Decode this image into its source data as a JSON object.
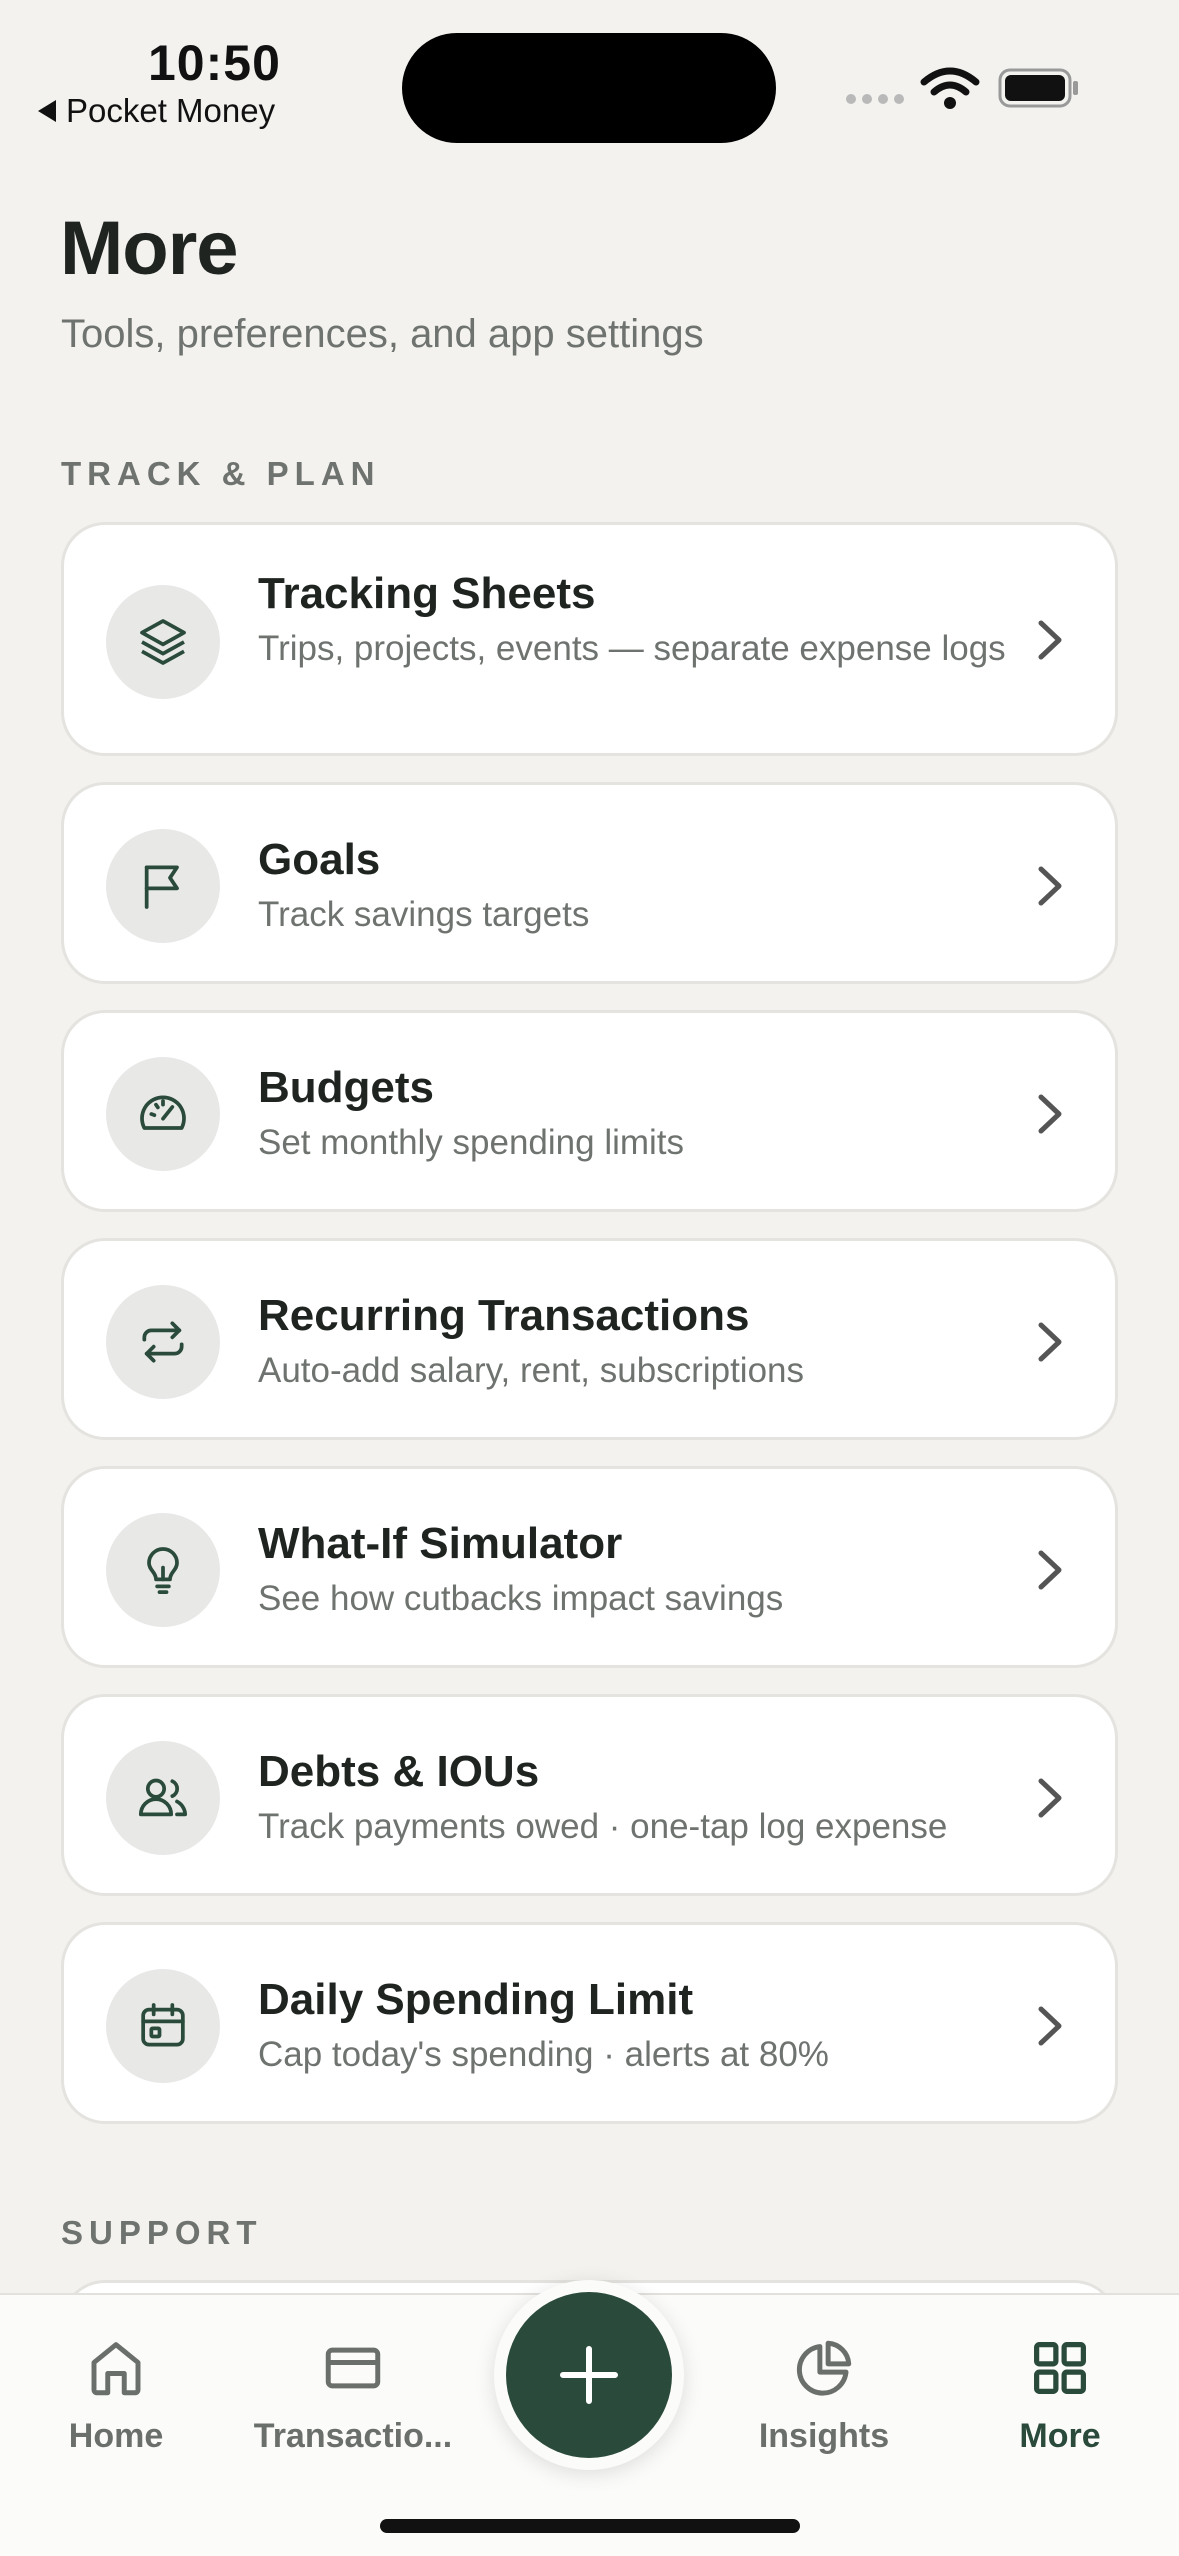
{
  "status_bar": {
    "time": "10:50",
    "back_app": "Pocket Money"
  },
  "header": {
    "title": "More",
    "subtitle": "Tools, preferences, and app settings"
  },
  "sections": {
    "track_plan_label": "TRACK & PLAN",
    "support_label": "SUPPORT"
  },
  "items": [
    {
      "title": "Tracking Sheets",
      "desc": "Trips, projects, events — separate expense logs",
      "icon": "layers-icon"
    },
    {
      "title": "Goals",
      "desc": "Track savings targets",
      "icon": "flag-icon"
    },
    {
      "title": "Budgets",
      "desc": "Set monthly spending limits",
      "icon": "gauge-icon"
    },
    {
      "title": "Recurring Transactions",
      "desc": "Auto-add salary, rent, subscriptions",
      "icon": "repeat-icon"
    },
    {
      "title": "What-If Simulator",
      "desc": "See how cutbacks impact savings",
      "icon": "lightbulb-icon"
    },
    {
      "title": "Debts & IOUs",
      "desc": "Track payments owed · one-tap log expense",
      "icon": "users-icon"
    },
    {
      "title": "Daily Spending Limit",
      "desc": "Cap today's spending · alerts at 80%",
      "icon": "calendar-icon"
    }
  ],
  "tabbar": {
    "home": "Home",
    "transactions": "Transactio...",
    "insights": "Insights",
    "more": "More",
    "active": "more"
  },
  "colors": {
    "accent": "#2a4a3b",
    "background": "#f3f2ef",
    "card": "#ffffff",
    "muted_text": "#6f736f"
  }
}
